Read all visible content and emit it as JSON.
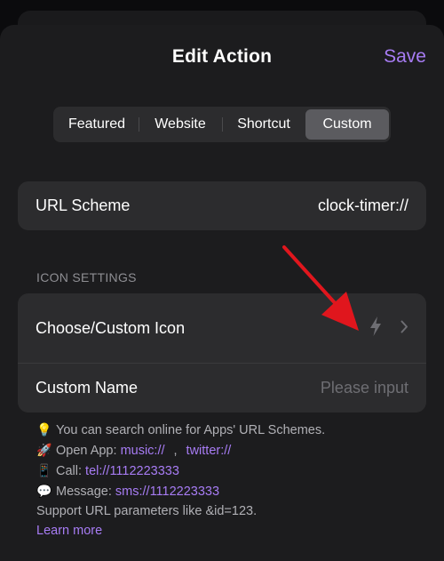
{
  "header": {
    "title": "Edit Action",
    "save_label": "Save"
  },
  "segments": [
    {
      "label": "Featured"
    },
    {
      "label": "Website"
    },
    {
      "label": "Shortcut"
    },
    {
      "label": "Custom",
      "selected": true
    }
  ],
  "url_scheme": {
    "label": "URL Scheme",
    "value": "clock-timer://"
  },
  "icon_settings": {
    "section_title": "ICON SETTINGS",
    "choose_icon_label": "Choose/Custom Icon",
    "current_icon": "lightning-bolt-icon",
    "custom_name_label": "Custom Name",
    "custom_name_placeholder": "Please input"
  },
  "help": {
    "line1": "You can search online for Apps' URL Schemes.",
    "open_app_prefix": "Open App:",
    "open_app_link1": "music://",
    "open_app_link2": "twitter://",
    "call_prefix": "Call:",
    "call_link": "tel://1112223333",
    "message_prefix": "Message:",
    "message_link": "sms://1112223333",
    "params_note": "Support URL parameters like &id=123.",
    "learn_more": "Learn more"
  },
  "colors": {
    "accent": "#a77cf4",
    "annotation_arrow": "#e0161d"
  }
}
